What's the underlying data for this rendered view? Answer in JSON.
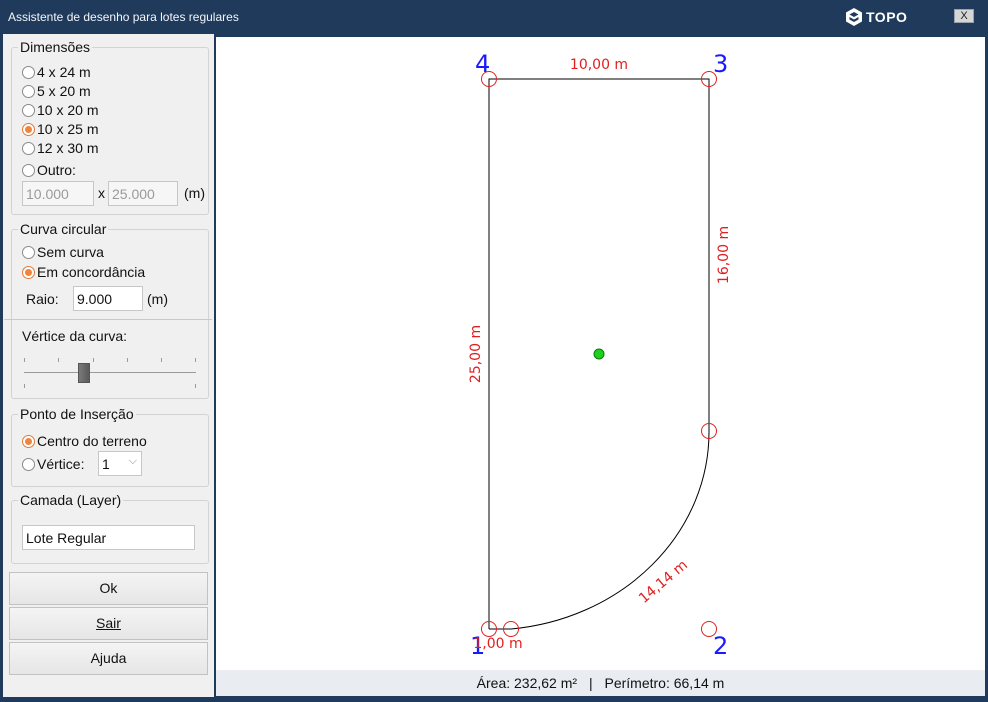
{
  "window": {
    "title": "Assistente de desenho para lotes regulares",
    "logo_text": "TOPO",
    "close_label": "X"
  },
  "dimensions": {
    "legend": "Dimensões",
    "options": [
      "4 x 24 m",
      "5 x 20 m",
      "10 x 20 m",
      "10 x 25 m",
      "12 x 30 m",
      "Outro:"
    ],
    "selected": "10 x 25 m",
    "width_value": "10.000",
    "x_label": "x",
    "length_value": "25.000",
    "unit": "(m)"
  },
  "curve": {
    "legend": "Curva circular",
    "options": [
      "Sem curva",
      "Em concordância"
    ],
    "selected": "Em concordância",
    "radius_label": "Raio:",
    "radius_value": "9.000",
    "unit": "(m)",
    "vertex_label": "Vértice da curva:",
    "slider_position": 0.35
  },
  "insertion": {
    "legend": "Ponto de Inserção",
    "options": [
      "Centro do terreno",
      "Vértice:"
    ],
    "selected": "Centro do terreno",
    "vertex_value": "1"
  },
  "layer": {
    "legend": "Camada (Layer)",
    "value": "Lote Regular"
  },
  "buttons": {
    "ok": "Ok",
    "exit": "Sair",
    "help": "Ajuda"
  },
  "drawing": {
    "vertex_labels": [
      "1",
      "2",
      "3",
      "4"
    ],
    "dimension_labels": {
      "top": "10,00 m",
      "right": "16,00 m",
      "left": "25,00 m",
      "arc": "14,14 m",
      "bottom": "1,00 m"
    },
    "colors": {
      "vertex_label": "#1a1aff",
      "dimension": "#e02020",
      "outline": "#000000",
      "center_point": "#1fd11f"
    }
  },
  "status": {
    "area": "Área: 232,62 m²",
    "separator": "|",
    "perimeter": "Perímetro: 66,14 m"
  }
}
